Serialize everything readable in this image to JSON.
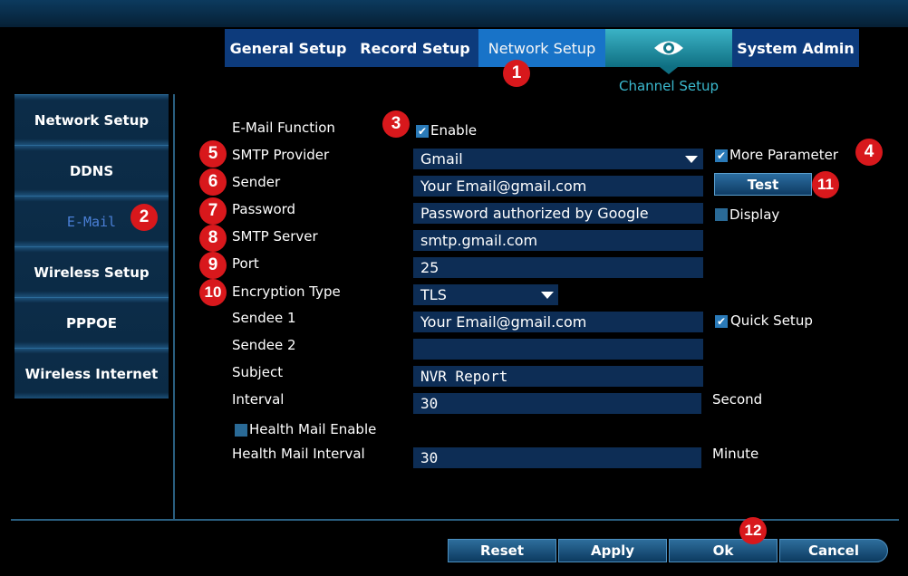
{
  "tabs": {
    "general": "General Setup",
    "record": "Record Setup",
    "network": "Network Setup",
    "system": "System Admin",
    "channel": "Channel Setup"
  },
  "sidebar": {
    "items": [
      {
        "label": "Network Setup"
      },
      {
        "label": "DDNS"
      },
      {
        "label": "E-Mail"
      },
      {
        "label": "Wireless Setup"
      },
      {
        "label": "PPPOE"
      },
      {
        "label": "Wireless Internet"
      }
    ]
  },
  "form": {
    "email_function": {
      "label": "E-Mail Function",
      "checkbox_label": "Enable",
      "checked": true
    },
    "smtp_provider": {
      "label": "SMTP Provider",
      "value": "Gmail"
    },
    "more_parameter": {
      "label": "More Parameter",
      "checked": true
    },
    "sender": {
      "label": "Sender",
      "value": "Your Email@gmail.com"
    },
    "test_button": "Test",
    "password": {
      "label": "Password",
      "value": "Password authorized by Google"
    },
    "display": {
      "label": "Display",
      "checked": false
    },
    "smtp_server": {
      "label": "SMTP Server",
      "value": "smtp.gmail.com"
    },
    "port": {
      "label": "Port",
      "value": "25"
    },
    "encryption": {
      "label": "Encryption Type",
      "value": "TLS"
    },
    "sendee1": {
      "label": "Sendee 1",
      "value": "Your Email@gmail.com"
    },
    "quick_setup": {
      "label": "Quick Setup",
      "checked": true
    },
    "sendee2": {
      "label": "Sendee 2",
      "value": ""
    },
    "subject": {
      "label": "Subject",
      "value": "NVR Report"
    },
    "interval": {
      "label": "Interval",
      "value": "30",
      "unit": "Second"
    },
    "health_mail_enable": {
      "label": "Health Mail Enable",
      "checked": false
    },
    "health_mail_interval": {
      "label": "Health Mail Interval",
      "value": "30",
      "unit": "Minute"
    }
  },
  "buttons": {
    "reset": "Reset",
    "apply": "Apply",
    "ok": "Ok",
    "cancel": "Cancel"
  },
  "badges": [
    "1",
    "2",
    "3",
    "4",
    "5",
    "6",
    "7",
    "8",
    "9",
    "10",
    "11",
    "12"
  ],
  "colors": {
    "badge": "#d8181c",
    "active_tab": "#1873c8",
    "tab": "#0d3b7c",
    "channel_accent": "#3bbad0"
  }
}
